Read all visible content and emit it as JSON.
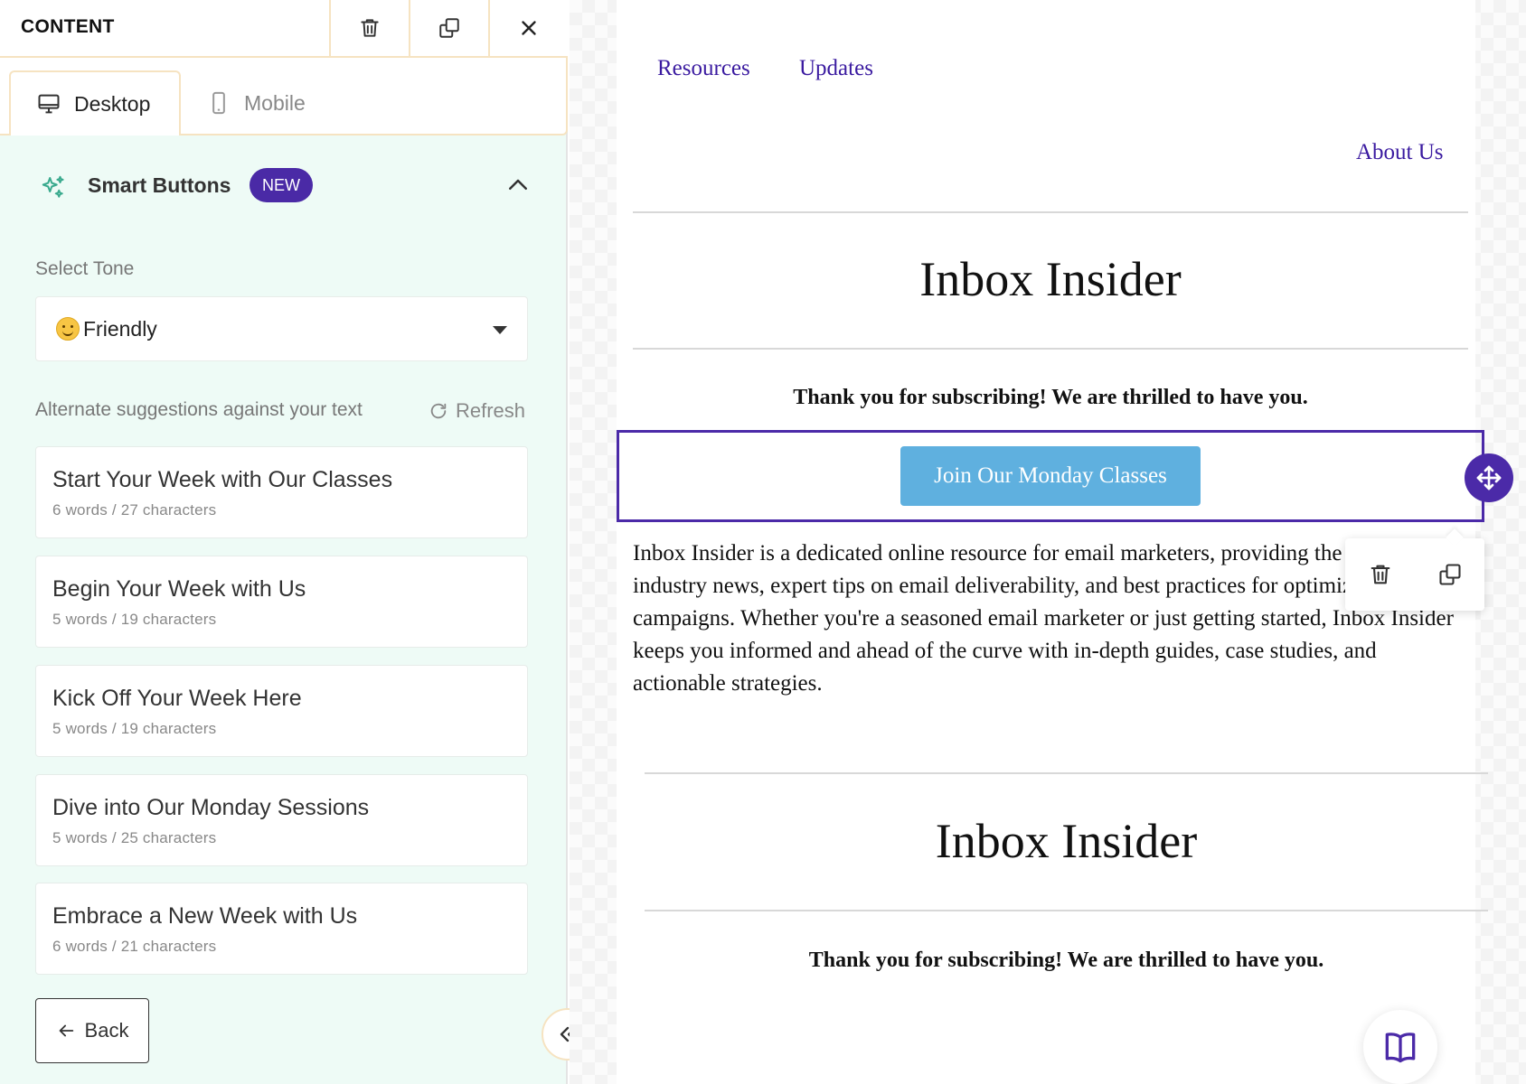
{
  "panel": {
    "title": "CONTENT",
    "tabs": [
      {
        "label": "Desktop",
        "active": true,
        "icon": "desktop-icon"
      },
      {
        "label": "Mobile",
        "active": false,
        "icon": "mobile-icon"
      }
    ]
  },
  "smart_buttons": {
    "title": "Smart Buttons",
    "badge": "NEW",
    "expanded": true
  },
  "tone": {
    "label": "Select Tone",
    "value": "Friendly",
    "emoji": "smiling-face-icon"
  },
  "suggestions": {
    "label": "Alternate suggestions against your text",
    "refresh_label": "Refresh",
    "items": [
      {
        "title": "Start Your Week with Our Classes",
        "meta": "6 words / 27 characters"
      },
      {
        "title": "Begin Your Week with Us",
        "meta": "5 words / 19 characters"
      },
      {
        "title": "Kick Off Your Week Here",
        "meta": "5 words / 19 characters"
      },
      {
        "title": "Dive into Our Monday Sessions",
        "meta": "5 words / 25 characters"
      },
      {
        "title": "Embrace a New Week with Us",
        "meta": "6 words / 21 characters"
      }
    ]
  },
  "back_label": "Back",
  "email": {
    "nav": [
      "Resources",
      "Updates",
      "About Us"
    ],
    "title": "Inbox Insider",
    "thanks": "Thank you for subscribing! We are thrilled to have you.",
    "cta_label": "Join Our Monday Classes",
    "body": "Inbox Insider is a dedicated online resource for email marketers, providing the latest industry news, expert tips on email deliverability, and best practices for optimizing campaigns. Whether you're a seasoned email marketer or just getting started, Inbox Insider keeps you informed and ahead of the curve with in-depth guides, case studies, and actionable strategies.",
    "title_2": "Inbox Insider",
    "thanks_2": "Thank you for subscribing! We are thrilled to have you."
  },
  "colors": {
    "accent": "#4a2aa6",
    "panel_bg": "#eefbf6",
    "cta_bg": "#5fb0df",
    "link": "#3a1aa0",
    "sparkle": "#3aaa8e"
  }
}
